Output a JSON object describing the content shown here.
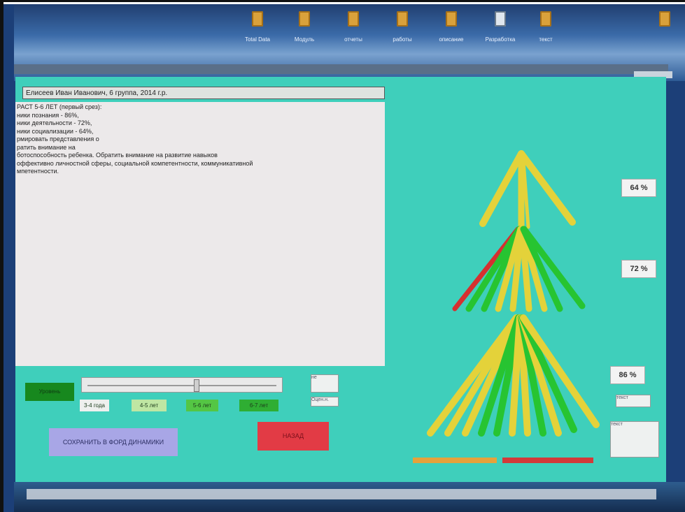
{
  "desktop": {
    "icons": [
      {
        "label": "Total Data"
      },
      {
        "label": "Модуль"
      },
      {
        "label": "отчеты"
      },
      {
        "label": "работы"
      },
      {
        "label": "описание"
      },
      {
        "label": "Разработка"
      },
      {
        "label": "текст"
      }
    ]
  },
  "form": {
    "child_name": "Елисеев Иван Иванович, 6 группа, 2014 г.р.",
    "report_lines": [
      "РАСТ 5-6 ЛЕТ (первый срез):",
      "ники познания - 86%,",
      "ники деятельности - 72%,",
      "ники социализации - 64%,",
      "рмировать представления о",
      "ратить внимание на",
      "ботоспособность ребенка. Обратить внимание на развитие навыков",
      "оффективно личностной сферы, социальной компетентности, коммуникативной",
      "мпетентности."
    ],
    "level_label": "Уровень",
    "slider_value": 0.57,
    "age_buttons": [
      "3-4 года",
      "4-5 лет",
      "5-6 лет",
      "6-7 лет"
    ],
    "save_button": "СОХРАНИТЬ В ФОРД ДИНАМИКИ",
    "back_button": "НАЗАД",
    "small_fields": [
      "не",
      "Оцен.н.",
      "текст",
      "текст"
    ]
  },
  "tree": {
    "percentages": [
      "64 %",
      "72 %",
      "86 %"
    ],
    "colors": {
      "yellow": "#e4d23a",
      "green": "#27c431",
      "red": "#d53030"
    }
  },
  "colors": {
    "app_bg": "#3fcfbb",
    "save_btn": "#a8a6e6",
    "back_btn": "#e23b45"
  }
}
